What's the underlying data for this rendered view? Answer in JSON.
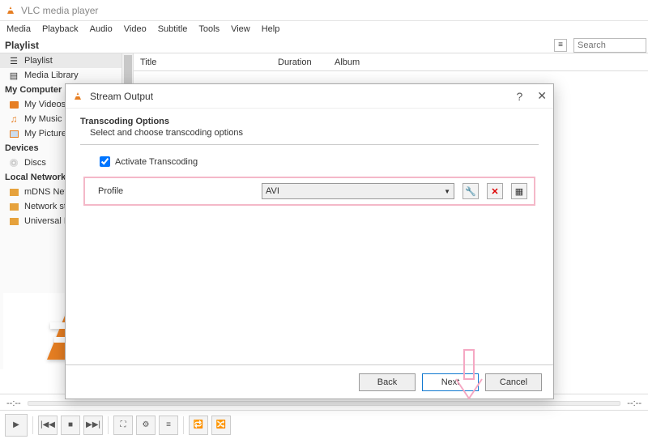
{
  "window": {
    "title": "VLC media player"
  },
  "menu": [
    "Media",
    "Playback",
    "Audio",
    "Video",
    "Subtitle",
    "Tools",
    "View",
    "Help"
  ],
  "playlist_header": "Playlist",
  "search_placeholder": "Search",
  "columns": {
    "title": "Title",
    "duration": "Duration",
    "album": "Album"
  },
  "sidebar": {
    "groups": [
      {
        "label": "",
        "items": [
          {
            "label": "Playlist",
            "icon": "playlist",
            "selected": true
          },
          {
            "label": "Media Library",
            "icon": "library"
          }
        ]
      },
      {
        "label": "My Computer",
        "items": [
          {
            "label": "My Videos",
            "icon": "video"
          },
          {
            "label": "My Music",
            "icon": "music"
          },
          {
            "label": "My Pictures",
            "icon": "picture"
          }
        ]
      },
      {
        "label": "Devices",
        "items": [
          {
            "label": "Discs",
            "icon": "disc"
          }
        ]
      },
      {
        "label": "Local Network",
        "items": [
          {
            "label": "mDNS Network",
            "icon": "net"
          },
          {
            "label": "Network streams",
            "icon": "net"
          },
          {
            "label": "Universal Plug'n'Play",
            "icon": "net"
          }
        ]
      }
    ]
  },
  "timeline": {
    "left": "--:--",
    "right": "--:--"
  },
  "dialog": {
    "title": "Stream Output",
    "section_title": "Transcoding Options",
    "section_sub": "Select and choose transcoding options",
    "activate_label": "Activate Transcoding",
    "activate_checked": true,
    "profile_label": "Profile",
    "profile_value": "AVI",
    "buttons": {
      "back": "Back",
      "next": "Next",
      "cancel": "Cancel"
    }
  }
}
